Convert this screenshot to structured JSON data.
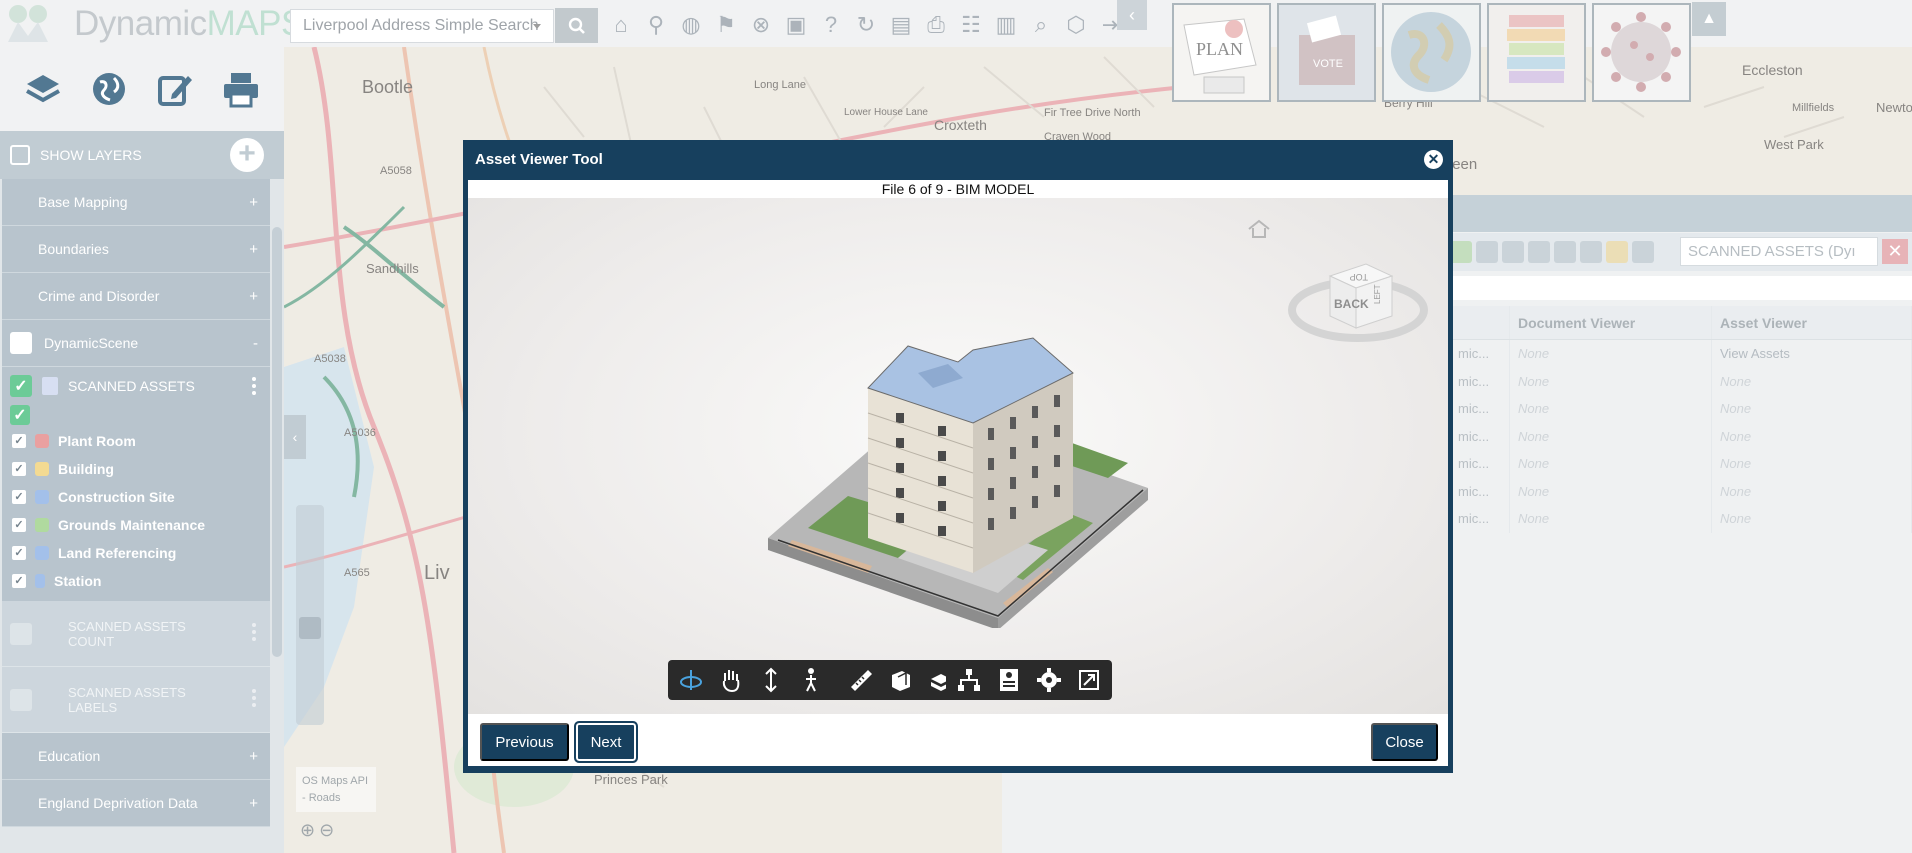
{
  "app": {
    "logo_text_a": "Dynamic",
    "logo_text_b": "MAPS",
    "brand_color": "#b3d9c9",
    "modal_color": "#17405e"
  },
  "search": {
    "placeholder": "Liverpool Address Simple Search"
  },
  "toolbar_icons": [
    "home-icon",
    "person-pin-icon",
    "globe-icon",
    "map-pin-icon",
    "cancel-icon",
    "panel-icon",
    "help-icon",
    "refresh-icon",
    "report-icon",
    "print-icon",
    "group-icon",
    "save-icon",
    "magnify-icon",
    "cube-icon",
    "exit-icon"
  ],
  "thumbnails": [
    {
      "name": "plan-thumbnail",
      "caption": "PLAN"
    },
    {
      "name": "vote-thumbnail",
      "caption": "VOTE"
    },
    {
      "name": "globe-thumbnail",
      "caption": ""
    },
    {
      "name": "books-thumbnail",
      "caption": ""
    },
    {
      "name": "virus-thumbnail",
      "caption": ""
    }
  ],
  "sidebar": {
    "show_layers": "SHOW LAYERS",
    "groups_top": [
      {
        "label": "Base Mapping",
        "sign": "+"
      },
      {
        "label": "Boundaries",
        "sign": "+"
      },
      {
        "label": "Crime and Disorder",
        "sign": "+"
      }
    ],
    "dynamic_scene": {
      "label": "DynamicScene",
      "sign": "-"
    },
    "scanned_assets": {
      "label": "SCANNED ASSETS",
      "items": [
        {
          "label": "Plant Room",
          "color": "#e58b8b"
        },
        {
          "label": "Building",
          "color": "#f1d27a"
        },
        {
          "label": "Construction Site",
          "color": "#8fb3e6"
        },
        {
          "label": "Grounds Maintenance",
          "color": "#9fd28a"
        },
        {
          "label": "Land Referencing",
          "color": "#8fb3e6"
        },
        {
          "label": "Station",
          "color": "#8fb3e6"
        }
      ]
    },
    "muted": [
      {
        "line1": "SCANNED ASSETS",
        "line2": "COUNT"
      },
      {
        "line1": "SCANNED ASSETS",
        "line2": "LABELS"
      }
    ],
    "groups_bottom": [
      {
        "label": "Education",
        "sign": "+"
      },
      {
        "label": "England Deprivation Data",
        "sign": "+"
      }
    ]
  },
  "map": {
    "labels": [
      "Bootle",
      "Sandhills",
      "Liv",
      "Croxteth",
      "Gillar's Green",
      "Eccleston",
      "West Park",
      "Newto",
      "Millfields",
      "Berry Hill",
      "Princes Park",
      "Long Lane",
      "Fir Tree Drive North",
      "Lower House Lane",
      "Craven Wood",
      "A5058",
      "A5038",
      "A5036",
      "A565"
    ],
    "attribution": [
      "OS Maps API",
      "- Roads"
    ]
  },
  "right_panel": {
    "select_value": "SCANNED ASSETS (Dyı",
    "columns": [
      "",
      "Document Viewer",
      "Asset Viewer"
    ],
    "rows": [
      [
        "mic...",
        "None",
        "View Assets"
      ],
      [
        "mic...",
        "None",
        "None"
      ],
      [
        "mic...",
        "None",
        "None"
      ],
      [
        "mic...",
        "None",
        "None"
      ],
      [
        "mic...",
        "None",
        "None"
      ],
      [
        "mic...",
        "None",
        "None"
      ],
      [
        "mic...",
        "None",
        "None"
      ]
    ]
  },
  "modal": {
    "title": "Asset Viewer Tool",
    "file_label": "File 6 of 9 - BIM MODEL",
    "viewcube": {
      "top": "TOP",
      "back": "BACK",
      "left": "LEFT"
    },
    "buttons": {
      "previous": "Previous",
      "next": "Next",
      "close": "Close"
    },
    "toolbar_groups": [
      [
        "orbit-icon",
        "pan-icon",
        "zoom-icon",
        "walk-icon",
        "camera-icon"
      ],
      [
        "measure-icon",
        "section-icon",
        "explode-icon"
      ],
      [
        "model-browser-icon",
        "properties-icon",
        "settings-icon",
        "fullscreen-icon"
      ]
    ]
  }
}
